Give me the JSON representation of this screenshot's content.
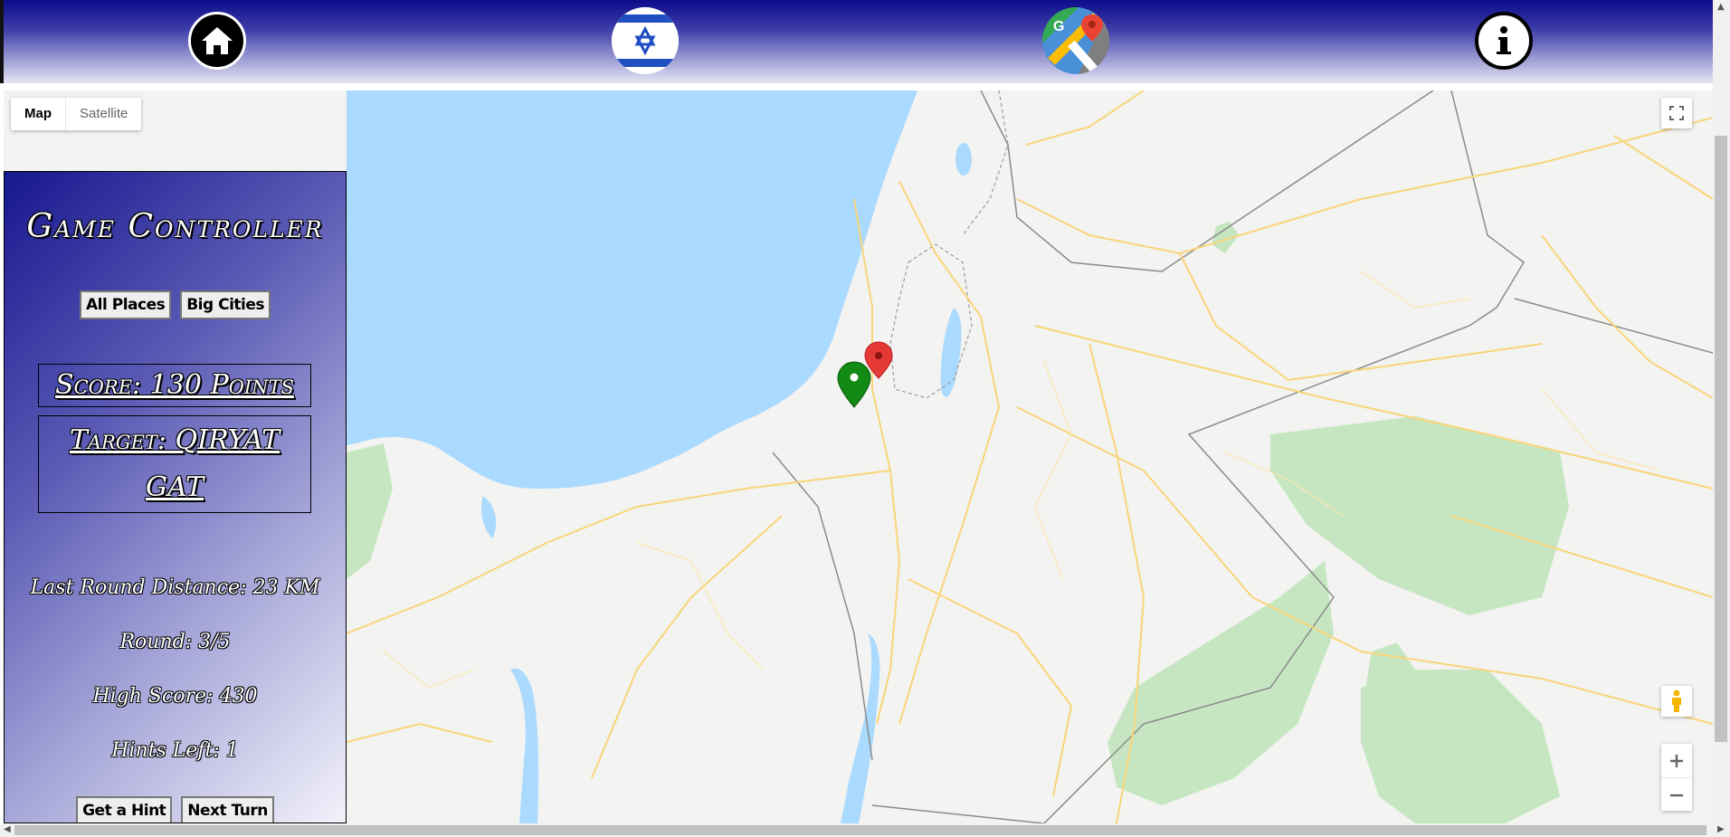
{
  "nav": {
    "home_icon": "home-icon",
    "flag_icon": "israel-flag-icon",
    "maps_icon": "google-maps-icon",
    "info_icon": "info-icon"
  },
  "map": {
    "type_map_label": "Map",
    "type_satellite_label": "Satellite",
    "selected_type": "Map",
    "marker_colors": {
      "target": "#1a7f1a",
      "guess": "#e53935"
    },
    "water_color": "#aadaff",
    "park_color": "#c6e6c2"
  },
  "panel": {
    "title": "Game Controller",
    "mode_all_places": "All Places",
    "mode_big_cities": "Big Cities",
    "score": "Score: 130 Points",
    "target": "Target: QIRYAT GAT",
    "last_round_distance": "Last Round Distance: 23 KM",
    "round": "Round: 3/5",
    "high_score": "High Score: 430",
    "hints_left": "Hints Left: 1",
    "hint_button": "Get a Hint",
    "next_button": "Next Turn",
    "gradient_colors": [
      "#17178f",
      "#f2f2fb"
    ]
  }
}
